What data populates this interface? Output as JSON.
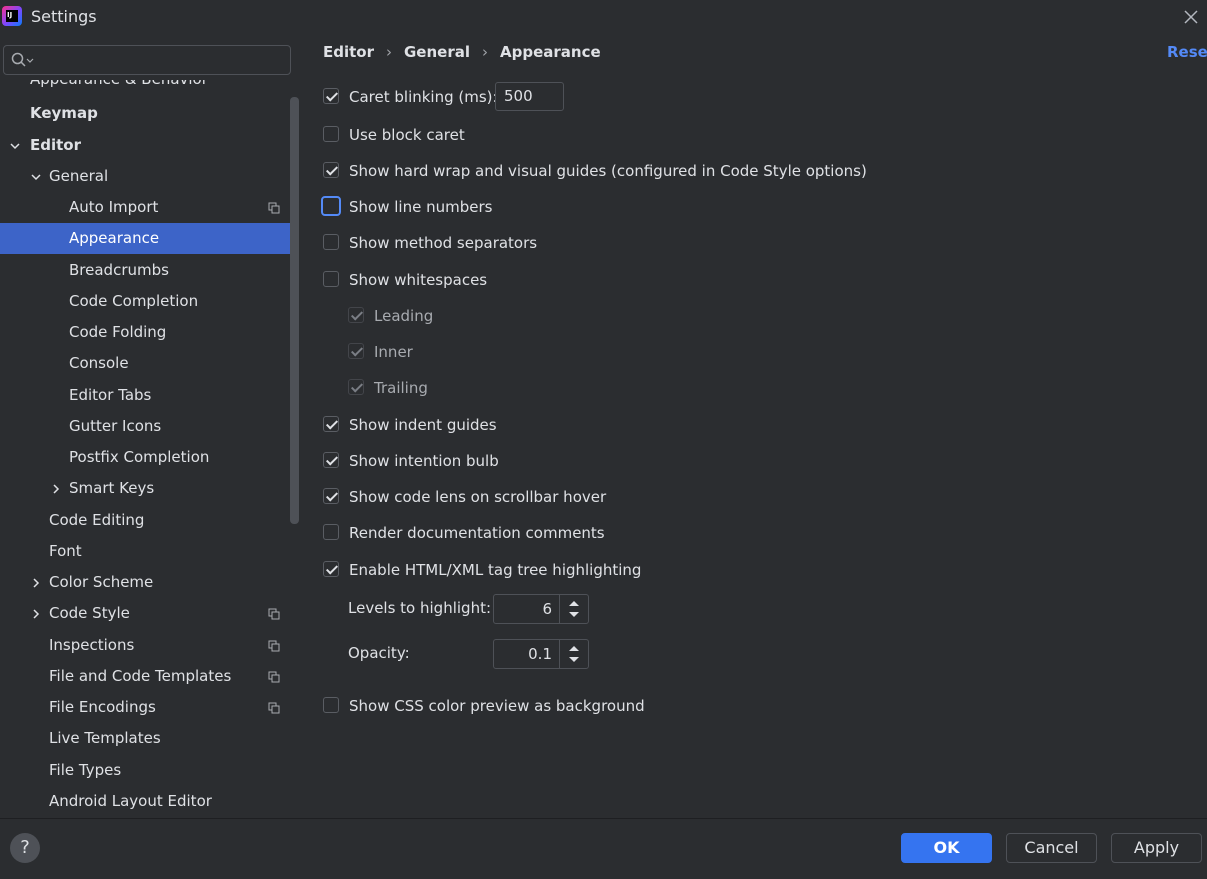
{
  "window": {
    "title": "Settings",
    "logo_text": "IJ"
  },
  "search": {
    "placeholder": ""
  },
  "tree": {
    "cut_label": "Appearance & Behavior",
    "items": [
      {
        "label": "Keymap"
      },
      {
        "label": "Editor"
      },
      {
        "label": "General"
      },
      {
        "label": "Auto Import"
      },
      {
        "label": "Appearance"
      },
      {
        "label": "Breadcrumbs"
      },
      {
        "label": "Code Completion"
      },
      {
        "label": "Code Folding"
      },
      {
        "label": "Console"
      },
      {
        "label": "Editor Tabs"
      },
      {
        "label": "Gutter Icons"
      },
      {
        "label": "Postfix Completion"
      },
      {
        "label": "Smart Keys"
      },
      {
        "label": "Code Editing"
      },
      {
        "label": "Font"
      },
      {
        "label": "Color Scheme"
      },
      {
        "label": "Code Style"
      },
      {
        "label": "Inspections"
      },
      {
        "label": "File and Code Templates"
      },
      {
        "label": "File Encodings"
      },
      {
        "label": "Live Templates"
      },
      {
        "label": "File Types"
      },
      {
        "label": "Android Layout Editor"
      }
    ]
  },
  "breadcrumb": [
    "Editor",
    "General",
    "Appearance"
  ],
  "reset_label": "Reset",
  "options": {
    "caret_blinking": {
      "label": "Caret blinking (ms):",
      "checked": true,
      "value": "500"
    },
    "block_caret": {
      "label": "Use block caret",
      "checked": false
    },
    "hard_wrap": {
      "label": "Show hard wrap and visual guides (configured in Code Style options)",
      "checked": true
    },
    "line_numbers": {
      "label": "Show line numbers",
      "checked": false
    },
    "method_separators": {
      "label": "Show method separators",
      "checked": false
    },
    "whitespaces": {
      "label": "Show whitespaces",
      "checked": false
    },
    "leading": {
      "label": "Leading",
      "checked": true
    },
    "inner": {
      "label": "Inner",
      "checked": true
    },
    "trailing": {
      "label": "Trailing",
      "checked": true
    },
    "indent_guides": {
      "label": "Show indent guides",
      "checked": true
    },
    "intention_bulb": {
      "label": "Show intention bulb",
      "checked": true
    },
    "code_lens": {
      "label": "Show code lens on scrollbar hover",
      "checked": true
    },
    "render_docs": {
      "label": "Render documentation comments",
      "checked": false
    },
    "tag_tree": {
      "label": "Enable HTML/XML tag tree highlighting",
      "checked": true
    },
    "levels": {
      "label": "Levels to highlight:",
      "value": "6"
    },
    "opacity": {
      "label": "Opacity:",
      "value": "0.1"
    },
    "css_preview": {
      "label": "Show CSS color preview as background",
      "checked": false
    }
  },
  "buttons": {
    "help": "?",
    "ok": "OK",
    "cancel": "Cancel",
    "apply": "Apply"
  },
  "colors": {
    "background": "#2b2d30",
    "selection": "#3d64c8",
    "accent": "#548af7",
    "ok_button": "#3574f0"
  },
  "icons": [
    "settings-app-icon",
    "close-icon",
    "search-icon",
    "chevron-down-icon",
    "chevron-right-icon",
    "copy-icon",
    "help-icon",
    "spinner-up-down-icon"
  ]
}
